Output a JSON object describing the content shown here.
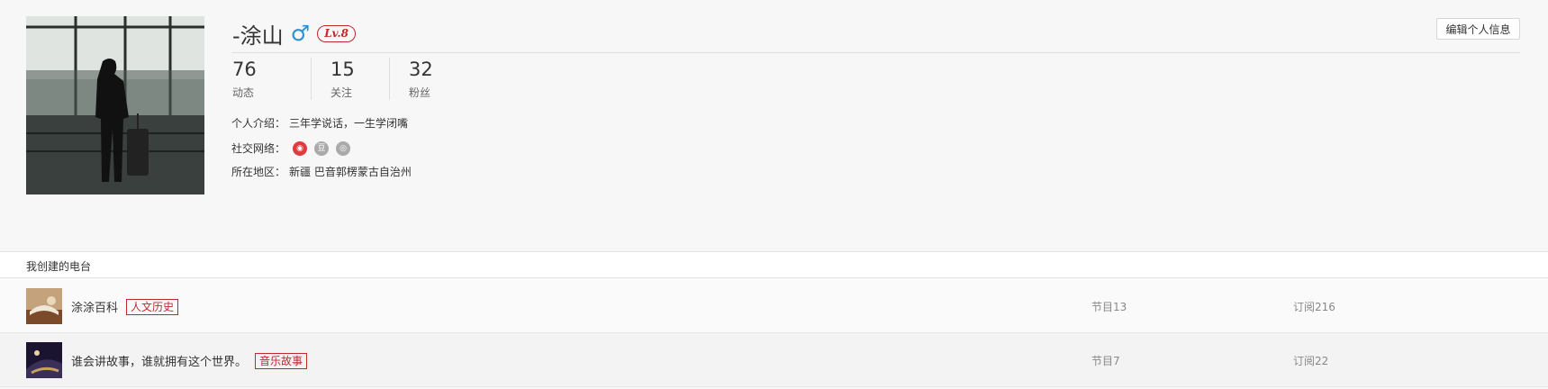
{
  "profile": {
    "nickname": "-涂山",
    "gender_symbol": "♂",
    "level": "Lv.8",
    "edit_button": "编辑个人信息",
    "stats": [
      {
        "value": "76",
        "label": "动态"
      },
      {
        "value": "15",
        "label": "关注"
      },
      {
        "value": "32",
        "label": "粉丝"
      }
    ],
    "intro_label": "个人介绍：",
    "intro_value": "三年学说话，一生学闭嘴",
    "social_label": "社交网络：",
    "social_icons": [
      "weibo-icon",
      "douban-icon",
      "other-social-icon"
    ],
    "social_colors": [
      "#e0393e",
      "#aaaaaa",
      "#aaaaaa"
    ],
    "region_label": "所在地区：",
    "region_value": "新疆 巴音郭楞蒙古自治州"
  },
  "radios": {
    "section_title": "我创建的电台",
    "items": [
      {
        "title": "涂涂百科",
        "tag": "人文历史",
        "programs": "节目13",
        "subscriptions": "订阅216"
      },
      {
        "title": "谁会讲故事，谁就拥有这个世界。",
        "tag": "音乐故事",
        "programs": "节目7",
        "subscriptions": "订阅22"
      }
    ]
  },
  "colors": {
    "accent_red": "#c0282f",
    "male_blue": "#2d8fcf"
  }
}
